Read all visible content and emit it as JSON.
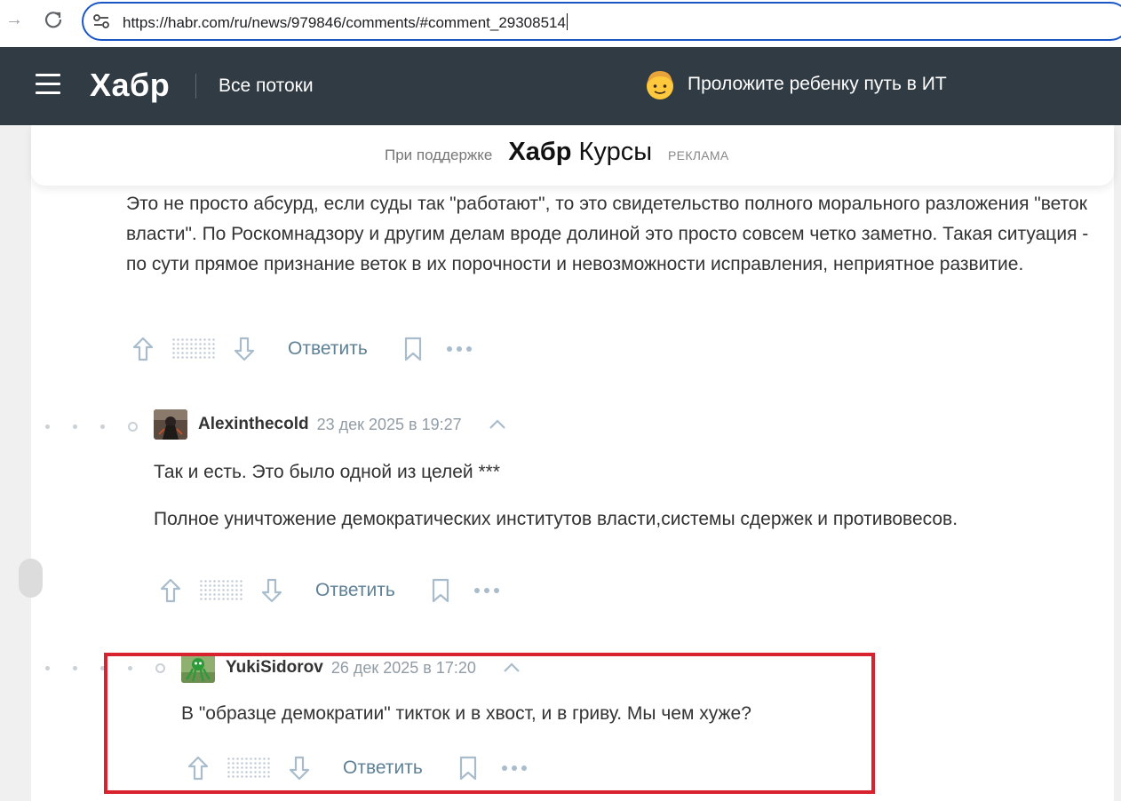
{
  "browser": {
    "url": "https://habr.com/ru/news/979846/comments/#comment_29308514"
  },
  "header": {
    "logo": "Хабр",
    "flows_label": "Все потоки",
    "promo_text": "Проложите ребенку путь в ИТ"
  },
  "sponsor": {
    "label": "При поддержке",
    "brand": "Хабр",
    "product": "Курсы",
    "ad_label": "РЕКЛАМА"
  },
  "comments": [
    {
      "paragraphs": [
        "Это не просто абсурд, если суды так \"работают\", то это свидетельство полного морального разложения \"веток власти\". По Роскомнадзору и другим делам вроде долиной это просто совсем четко заметно. Такая ситуация - по сути прямое признание веток в их порочности и невозможности исправления, неприятное развитие."
      ],
      "reply_label": "Ответить"
    },
    {
      "author": "Alexinthecold",
      "time": "23 дек 2025 в 19:27",
      "paragraphs": [
        "Так и есть. Это было одной из целей ***",
        "Полное уничтожение демократических институтов власти,системы сдержек и противовесов."
      ],
      "reply_label": "Ответить"
    },
    {
      "author": "YukiSidorov",
      "time": "26 дек 2025 в 17:20",
      "paragraphs": [
        "В \"образце демократии\" тикток и в хвост, и в гриву. Мы чем хуже?"
      ],
      "reply_label": "Ответить"
    }
  ],
  "colors": {
    "header_bg": "#303b44",
    "link": "#5f8196",
    "highlight": "#d8232f",
    "url_border": "#1a56c4"
  },
  "icons": {
    "upvote": "arrow-up-icon",
    "downvote": "arrow-down-icon",
    "bookmark": "bookmark-icon",
    "more": "more-dots-icon",
    "collapse": "chevron-up-icon"
  }
}
